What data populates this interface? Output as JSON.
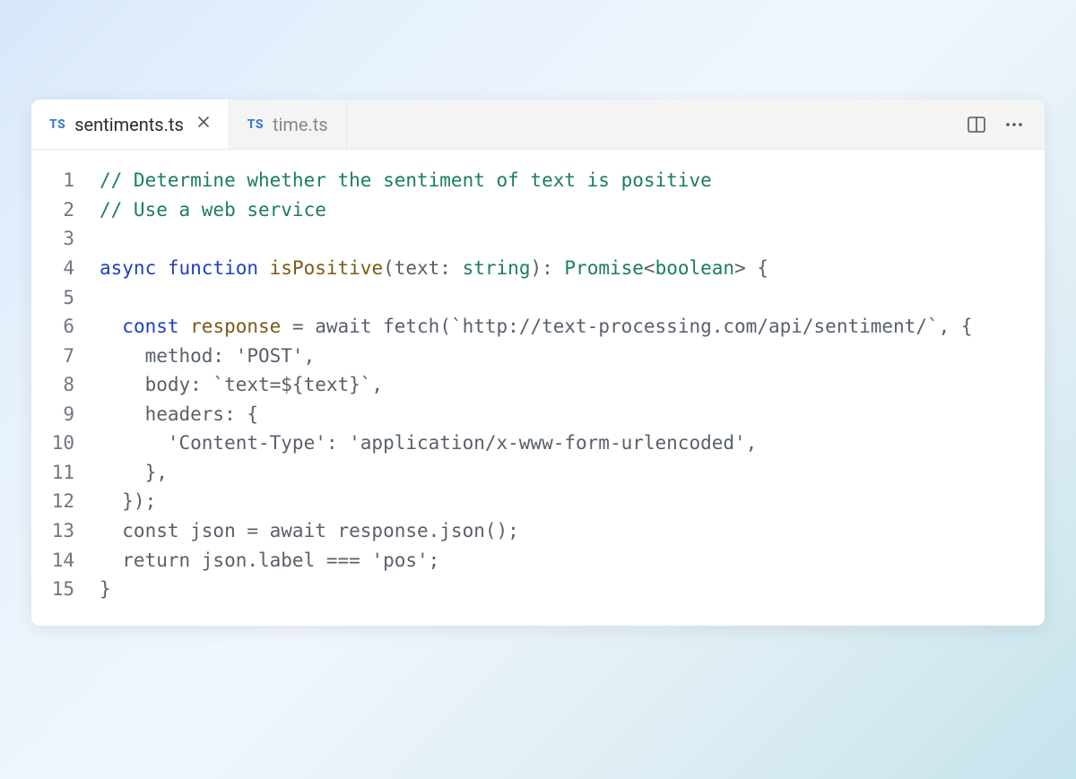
{
  "tabs": [
    {
      "badge": "TS",
      "name": "sentiments.ts",
      "active": true,
      "closeable": true
    },
    {
      "badge": "TS",
      "name": "time.ts",
      "active": false,
      "closeable": false
    }
  ],
  "code": {
    "lineNumbers": [
      "1",
      "2",
      "3",
      "4",
      "5",
      "6",
      "7",
      "8",
      "9",
      "10",
      "11",
      "12",
      "13",
      "14",
      "15"
    ],
    "lines": [
      [
        {
          "c": "tok-comment",
          "t": "// Determine whether the sentiment of text is positive"
        }
      ],
      [
        {
          "c": "tok-comment",
          "t": "// Use a web service"
        }
      ],
      [
        {
          "c": "tok-plain",
          "t": ""
        }
      ],
      [
        {
          "c": "tok-keyword",
          "t": "async function "
        },
        {
          "c": "tok-funcname",
          "t": "isPositive"
        },
        {
          "c": "tok-plain",
          "t": "(text: "
        },
        {
          "c": "tok-type",
          "t": "string"
        },
        {
          "c": "tok-plain",
          "t": "): "
        },
        {
          "c": "tok-type",
          "t": "Promise"
        },
        {
          "c": "tok-plain",
          "t": "<"
        },
        {
          "c": "tok-type",
          "t": "boolean"
        },
        {
          "c": "tok-plain",
          "t": "> {"
        }
      ],
      [
        {
          "c": "tok-plain",
          "t": ""
        }
      ],
      [
        {
          "c": "tok-plain",
          "t": "  "
        },
        {
          "c": "tok-keyword",
          "t": "const "
        },
        {
          "c": "tok-funcname",
          "t": "response"
        },
        {
          "c": "tok-plain",
          "t": " = await fetch(`http://text-processing.com/api/sentiment/`, {"
        }
      ],
      [
        {
          "c": "tok-plain",
          "t": "    method: 'POST',"
        }
      ],
      [
        {
          "c": "tok-plain",
          "t": "    body: `text=${text}`,"
        }
      ],
      [
        {
          "c": "tok-plain",
          "t": "    headers: {"
        }
      ],
      [
        {
          "c": "tok-plain",
          "t": "      'Content-Type': 'application/x-www-form-urlencoded',"
        }
      ],
      [
        {
          "c": "tok-plain",
          "t": "    },"
        }
      ],
      [
        {
          "c": "tok-plain",
          "t": "  });"
        }
      ],
      [
        {
          "c": "tok-plain",
          "t": "  const json = await response.json();"
        }
      ],
      [
        {
          "c": "tok-plain",
          "t": "  return json.label === 'pos';"
        }
      ],
      [
        {
          "c": "tok-plain",
          "t": "}"
        }
      ]
    ]
  }
}
